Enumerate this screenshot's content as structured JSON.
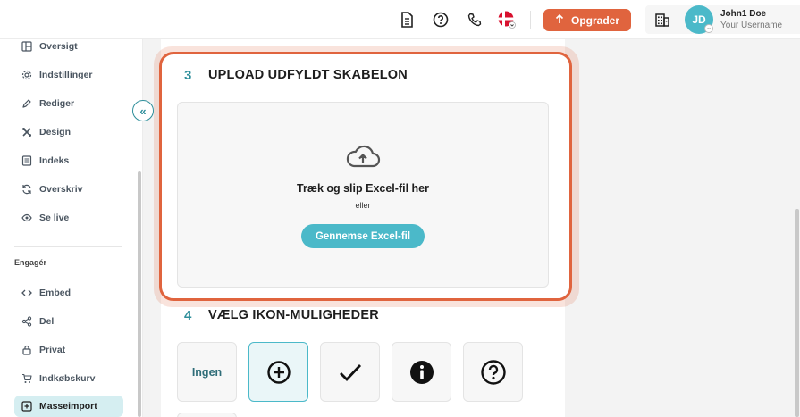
{
  "header": {
    "upgrade_label": "Opgrader",
    "user_initials": "JD",
    "user_name": "John1 Doe",
    "user_subtitle": "Your Username",
    "icons": [
      "document-icon",
      "help-icon",
      "phone-icon",
      "flag-denmark-icon",
      "building-icon"
    ]
  },
  "sidebar": {
    "items": [
      {
        "label": "Oversigt",
        "icon": "layout-icon"
      },
      {
        "label": "Indstillinger",
        "icon": "gear-icon"
      },
      {
        "label": "Rediger",
        "icon": "pencil-icon"
      },
      {
        "label": "Design",
        "icon": "tools-icon"
      },
      {
        "label": "Indeks",
        "icon": "list-icon"
      },
      {
        "label": "Overskriv",
        "icon": "refresh-icon"
      },
      {
        "label": "Se live",
        "icon": "eye-icon"
      }
    ],
    "section_heading": "Engagér",
    "engage_items": [
      {
        "label": "Embed",
        "icon": "code-icon"
      },
      {
        "label": "Del",
        "icon": "share-icon"
      },
      {
        "label": "Privat",
        "icon": "lock-icon"
      },
      {
        "label": "Indkøbskurv",
        "icon": "cart-icon"
      },
      {
        "label": "Masseimport",
        "icon": "import-icon",
        "active": true
      }
    ]
  },
  "upload": {
    "step": "3",
    "title": "UPLOAD UDFYLDT SKABELON",
    "drop_text": "Træk og slip Excel-fil her",
    "or_text": "eller",
    "browse_label": "Gennemse Excel-fil"
  },
  "icon_options": {
    "step": "4",
    "title": "VÆLG IKON-MULIGHEDER",
    "none_label": "Ingen",
    "selected": "plus-circle",
    "options": [
      "none",
      "plus-circle-icon",
      "checkmark-icon",
      "info-icon",
      "question-circle-icon"
    ]
  },
  "colors": {
    "accent": "#4bb9c9",
    "accent_dark": "#2f8f9b",
    "brand_orange": "#e0643e"
  }
}
